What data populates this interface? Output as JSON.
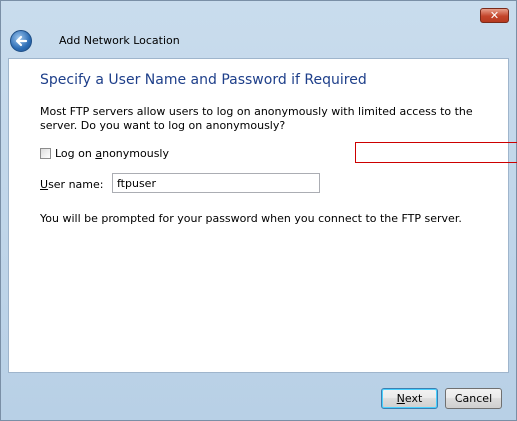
{
  "titlebar": {
    "close_glyph": "✕"
  },
  "header": {
    "title": "Add Network Location",
    "back_icon": "back-arrow-icon"
  },
  "main": {
    "heading": "Specify a User Name and Password if Required",
    "description": "Most FTP servers allow users to log on anonymously with limited access to the server.  Do you want to log on anonymously?",
    "anonymous_checkbox": {
      "label_pre": "Log on ",
      "label_accel": "a",
      "label_post": "nonymously",
      "checked": false
    },
    "user_name": {
      "label_accel": "U",
      "label_rest": "ser name:",
      "value": "ftpuser"
    },
    "prompt_note": "You will be prompted for your password when you connect to the FTP server."
  },
  "footer": {
    "next": {
      "accel": "N",
      "rest": "ext"
    },
    "cancel": "Cancel"
  }
}
